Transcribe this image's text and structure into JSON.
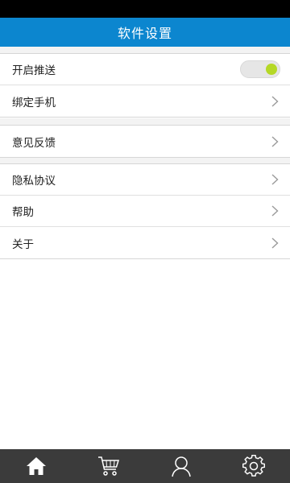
{
  "header": {
    "title": "软件设置"
  },
  "settings": {
    "push": {
      "label": "开启推送",
      "enabled": true,
      "accent_color": "#b5d826"
    },
    "bind_phone": {
      "label": "绑定手机"
    },
    "feedback": {
      "label": "意见反馈"
    },
    "privacy": {
      "label": "隐私协议"
    },
    "help": {
      "label": "帮助"
    },
    "about": {
      "label": "关于"
    }
  },
  "tab_bar": {
    "tabs": [
      {
        "icon": "home-icon",
        "active": true
      },
      {
        "icon": "cart-icon",
        "active": false
      },
      {
        "icon": "user-icon",
        "active": false
      },
      {
        "icon": "gear-icon",
        "active": false
      }
    ]
  },
  "colors": {
    "header": "#0c86cf",
    "tab_bar": "#3b3b3b"
  }
}
